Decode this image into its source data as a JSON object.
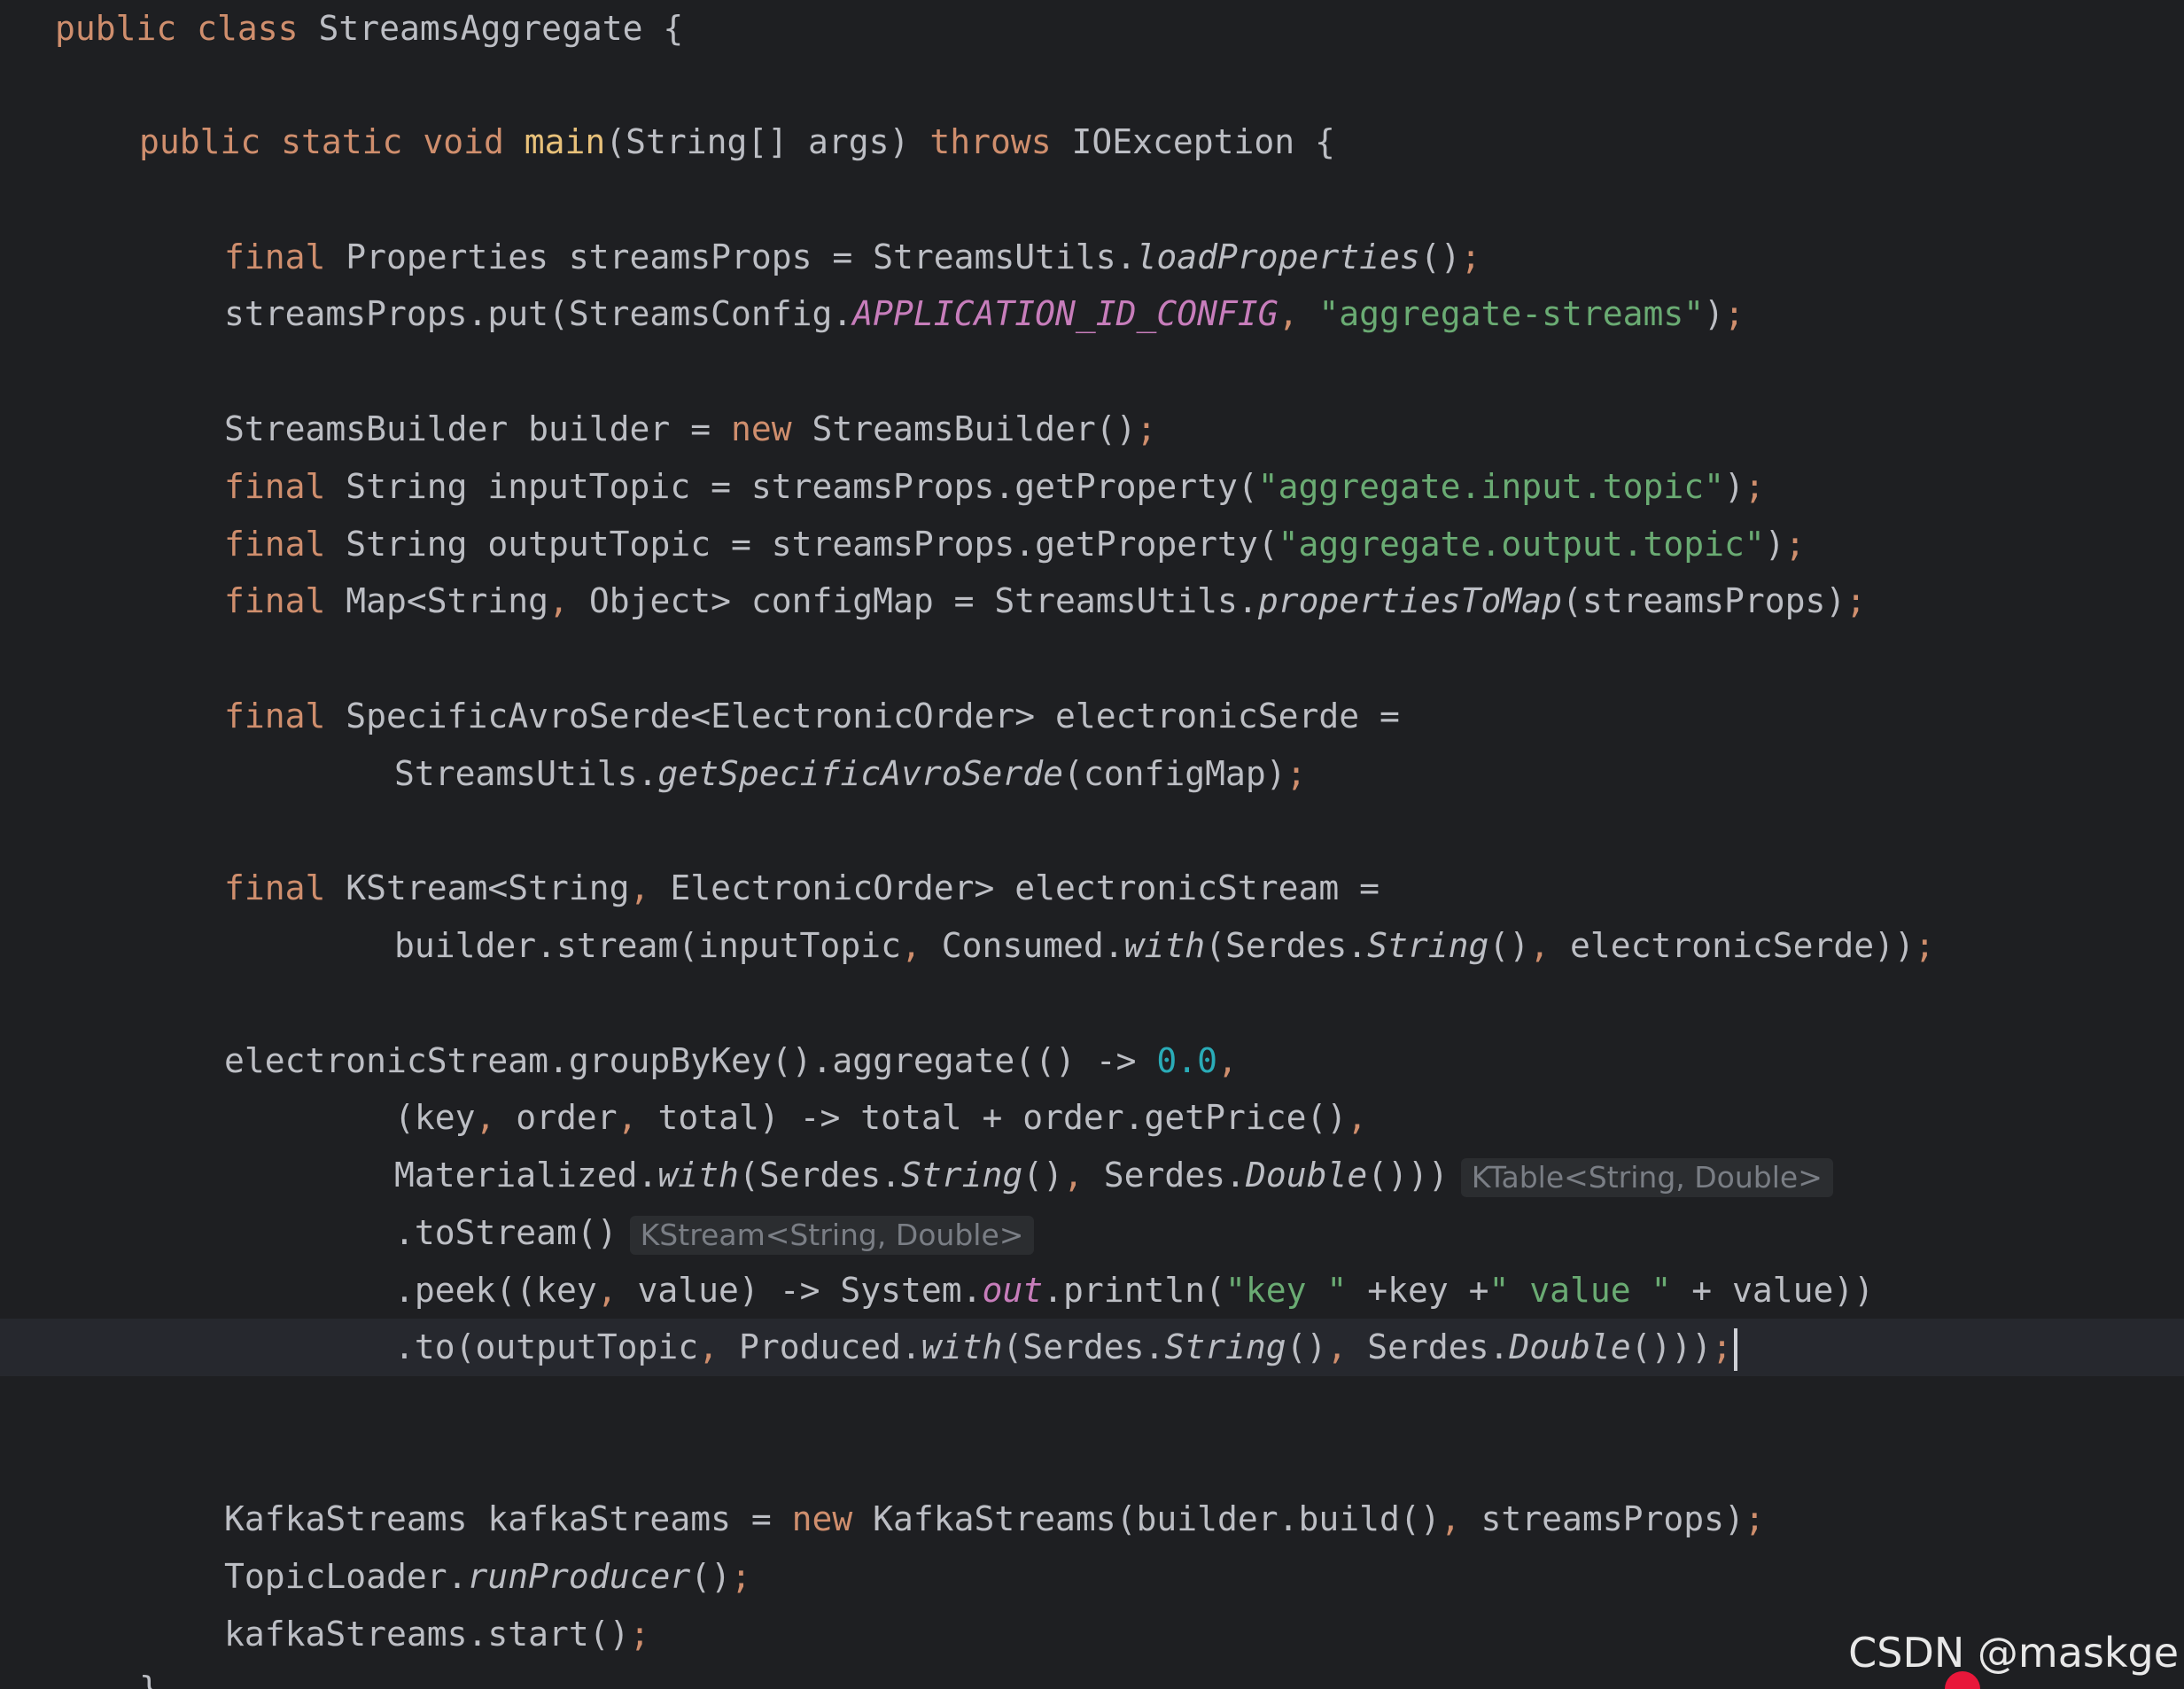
{
  "editor": {
    "lines": {
      "l1": {
        "kw1": "public",
        "kw2": "class",
        "name": "StreamsAggregate {"
      },
      "l2": {
        "kw1": "public",
        "kw2": "static",
        "kw3": "void",
        "method": "main",
        "params": "(String[] args) ",
        "throws": "throws",
        "rest": " IOException {"
      },
      "l3": {
        "kw": "final",
        "a": " Properties streamsProps = StreamsUtils.",
        "m": "loadProperties",
        "b": "()",
        "semi": ";"
      },
      "l4": {
        "a": "streamsProps.put(StreamsConfig.",
        "c": "APPLICATION_ID_CONFIG",
        "comma": ", ",
        "s": "\"aggregate-streams\"",
        "b": ")",
        "semi": ";"
      },
      "l5": {
        "a": "StreamsBuilder builder = ",
        "kw": "new",
        "b": " StreamsBuilder()",
        "semi": ";"
      },
      "l6": {
        "kw": "final",
        "a": " String inputTopic = streamsProps.getProperty(",
        "s": "\"aggregate.input.topic\"",
        "b": ")",
        "semi": ";"
      },
      "l7": {
        "kw": "final",
        "a": " String outputTopic = streamsProps.getProperty(",
        "s": "\"aggregate.output.topic\"",
        "b": ")",
        "semi": ";"
      },
      "l8": {
        "kw": "final",
        "a": " Map<String",
        "comma": ", ",
        "b": "Object> configMap = StreamsUtils.",
        "m": "propertiesToMap",
        "c": "(streamsProps)",
        "semi": ";"
      },
      "l9": {
        "kw": "final",
        "a": " SpecificAvroSerde<ElectronicOrder> electronicSerde ="
      },
      "l10": {
        "a": "StreamsUtils.",
        "m": "getSpecificAvroSerde",
        "b": "(configMap)",
        "semi": ";"
      },
      "l11": {
        "kw": "final",
        "a": " KStream<String",
        "comma": ", ",
        "b": "ElectronicOrder> electronicStream ="
      },
      "l12": {
        "a": "builder.stream(inputTopic",
        "comma1": ", ",
        "b": "Consumed.",
        "m1": "with",
        "c": "(Serdes.",
        "m2": "String",
        "d": "()",
        "comma2": ", ",
        "e": "electronicSerde))",
        "semi": ";"
      },
      "l13": {
        "a": "electronicStream.groupByKey().aggregate(() -> ",
        "n": "0.0",
        "comma": ","
      },
      "l14": {
        "a": "(key",
        "comma1": ", ",
        "b": "order",
        "comma2": ", ",
        "c": "total) -> total + order.getPrice()",
        "comma3": ","
      },
      "l15": {
        "a": "Materialized.",
        "m1": "with",
        "b": "(Serdes.",
        "m2": "String",
        "c": "()",
        "comma": ", ",
        "d": "Serdes.",
        "m3": "Double",
        "e": "()))",
        "hint": "KTable<String, Double>"
      },
      "l16": {
        "a": ".toStream()",
        "hint": "KStream<String, Double>"
      },
      "l17": {
        "a": ".peek((key",
        "comma": ", ",
        "b": "value) -> System.",
        "c": "out",
        "d": ".println(",
        "s1": "\"key \"",
        "e": " +key +",
        "s2": "\" value \"",
        "f": " + value))"
      },
      "l18": {
        "a": ".to(outputTopic",
        "comma1": ", ",
        "b": "Produced.",
        "m1": "with",
        "c": "(Serdes.",
        "m2": "String",
        "d": "()",
        "comma2": ", ",
        "e": "Serdes.",
        "m3": "Double",
        "f": "()))",
        "semi": ";"
      },
      "l19": {
        "a": "KafkaStreams kafkaStreams = ",
        "kw": "new",
        "b": " KafkaStreams(builder.build()",
        "comma": ", ",
        "c": "streamsProps)",
        "semi": ";"
      },
      "l20": {
        "a": "TopicLoader.",
        "m": "runProducer",
        "b": "()",
        "semi": ";"
      },
      "l21": {
        "a": "kafkaStreams.start()",
        "semi": ";"
      },
      "l22": {
        "a": "}"
      }
    }
  },
  "watermark": "CSDN @maskge",
  "colors": {
    "background": "#1e1f22",
    "keyword": "#cf8e6d",
    "string": "#6aab73",
    "number": "#2aacb8",
    "constant": "#c77dbb",
    "method_decl": "#e8c17a",
    "text": "#bcbec4"
  }
}
